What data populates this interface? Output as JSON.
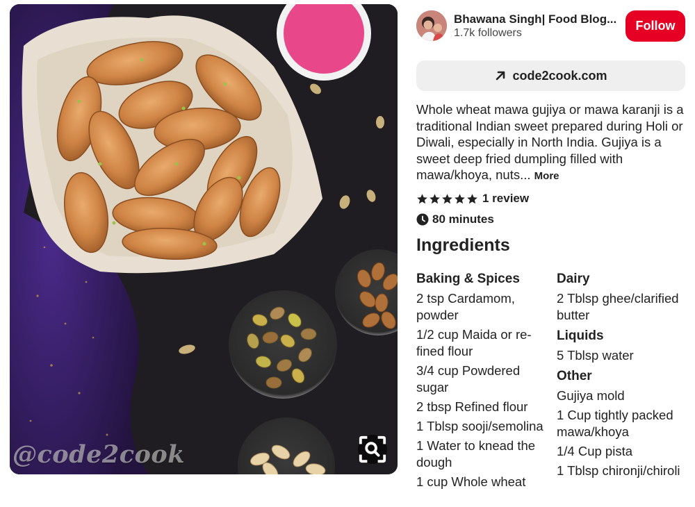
{
  "image": {
    "watermark": "@code2cook",
    "description_icon": "visual-search-icon"
  },
  "creator": {
    "name": "Bhawana Singh| Food Blog...",
    "followers": "1.7k followers",
    "follow_label": "Follow"
  },
  "link": {
    "icon": "arrow-up-right-icon",
    "label": "code2cook.com"
  },
  "description": {
    "text": "Whole wheat mawa gujiya or mawa karanji is a traditional Indian sweet prepared during Holi or Diwali, especially in North India. Gu­jiya is a sweet deep fried dumpling filled with mawa/khoya, nuts...",
    "more_label": "More"
  },
  "rating": {
    "stars": 5,
    "review_label": "1 review"
  },
  "time": {
    "label": "80 minutes"
  },
  "ingredients": {
    "heading": "Ingredients",
    "left": [
      {
        "section": "Baking & Spices",
        "items": [
          "2 tsp Cardamom, powder",
          "1/2 cup Maida or re­fined flour",
          "3/4 cup Powdered sugar",
          "2 tbsp Refined flour",
          "1 Tblsp sooji/semolina",
          "1 Water to knead the dough",
          "1 cup Whole wheat"
        ]
      }
    ],
    "right": [
      {
        "section": "Dairy",
        "items": [
          "2 Tblsp ghee/clari­fied butter"
        ]
      },
      {
        "section": "Liquids",
        "items": [
          "5 Tblsp water"
        ]
      },
      {
        "section": "Other",
        "items": [
          "Gujiya mold",
          "1 Cup tightly packed mawa/khoya",
          "1/4 Cup pista",
          "1 Tblsp chironji/chiroli"
        ]
      }
    ]
  },
  "colors": {
    "follow": "#e60023",
    "link_bg": "#efefef",
    "text": "#222222"
  }
}
